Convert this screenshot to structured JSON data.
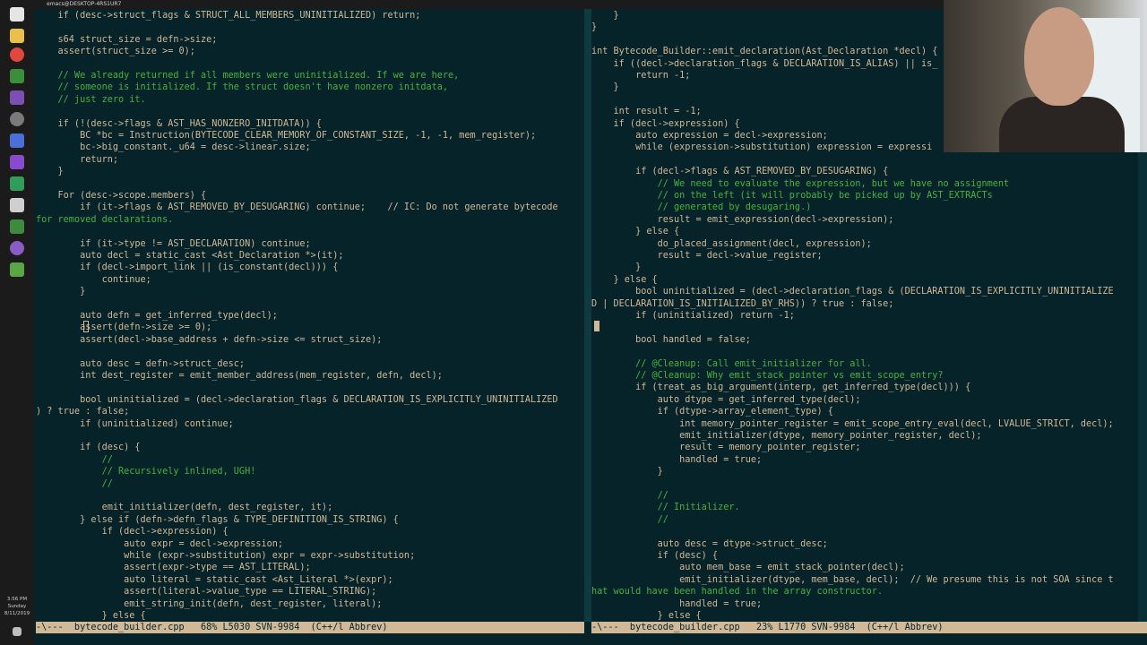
{
  "window_title": "emacs@DESKTOP-4RS1UR7",
  "taskbar": {
    "clock_time": "3:56 PM",
    "clock_day": "Sunday",
    "clock_date": "8/11/2019",
    "icons": [
      "windows-start-icon",
      "file-explorer-icon",
      "chrome-icon",
      "notepad-icon",
      "app-icon",
      "app-icon",
      "app-icon",
      "app-icon",
      "app-icon",
      "app-icon",
      "app-icon",
      "app-icon",
      "app-icon"
    ]
  },
  "colors": {
    "background": "#062329",
    "code": "#d1b897",
    "comment": "#44b340",
    "modeline_bg": "#d1b897"
  },
  "left_pane": {
    "lines": [
      {
        "t": "    if (desc->struct_flags & STRUCT_ALL_MEMBERS_UNINITIALIZED) return;",
        "c": false
      },
      {
        "t": "",
        "c": false
      },
      {
        "t": "    s64 struct_size = defn->size;",
        "c": false
      },
      {
        "t": "    assert(struct_size >= 0);",
        "c": false
      },
      {
        "t": "",
        "c": false
      },
      {
        "t": "    // We already returned if all members were uninitialized. If we are here,",
        "c": true
      },
      {
        "t": "    // someone is initialized. If the struct doesn't have nonzero initdata,",
        "c": true
      },
      {
        "t": "    // just zero it.",
        "c": true
      },
      {
        "t": "",
        "c": false
      },
      {
        "t": "    if (!(desc->flags & AST_HAS_NONZERO_INITDATA)) {",
        "c": false
      },
      {
        "t": "        BC *bc = Instruction(BYTECODE_CLEAR_MEMORY_OF_CONSTANT_SIZE, -1, -1, mem_register);",
        "c": false
      },
      {
        "t": "        bc->big_constant._u64 = desc->linear.size;",
        "c": false
      },
      {
        "t": "        return;",
        "c": false
      },
      {
        "t": "    }",
        "c": false
      },
      {
        "t": "",
        "c": false
      },
      {
        "t": "    For (desc->scope.members) {",
        "c": false
      },
      {
        "t": "        if (it->flags & AST_REMOVED_BY_DESUGARING) continue;    // IC: Do not generate bytecode",
        "c": false
      },
      {
        "t": "for removed declarations.",
        "c": true
      },
      {
        "t": "",
        "c": false
      },
      {
        "t": "        if (it->type != AST_DECLARATION) continue;",
        "c": false
      },
      {
        "t": "        auto decl = static_cast <Ast_Declaration *>(it);",
        "c": false
      },
      {
        "t": "        if (decl->import_link || (is_constant(decl))) {",
        "c": false
      },
      {
        "t": "            continue;",
        "c": false
      },
      {
        "t": "        }",
        "c": false
      },
      {
        "t": "",
        "c": false
      },
      {
        "t": "        auto defn = get_inferred_type(decl);",
        "c": false
      },
      {
        "t": "        assert(defn->size >= 0);",
        "c": false
      },
      {
        "t": "        assert(decl->base_address + defn->size <= struct_size);",
        "c": false
      },
      {
        "t": "",
        "c": false
      },
      {
        "t": "        auto desc = defn->struct_desc;",
        "c": false
      },
      {
        "t": "        int dest_register = emit_member_address(mem_register, defn, decl);",
        "c": false
      },
      {
        "t": "",
        "c": false
      },
      {
        "t": "        bool uninitialized = (decl->declaration_flags & DECLARATION_IS_EXPLICITLY_UNINITIALIZED",
        "c": false
      },
      {
        "t": ") ? true : false;",
        "c": false
      },
      {
        "t": "        if (uninitialized) continue;",
        "c": false
      },
      {
        "t": "",
        "c": false
      },
      {
        "t": "        if (desc) {",
        "c": false
      },
      {
        "t": "            //",
        "c": true
      },
      {
        "t": "            // Recursively inlined, UGH!",
        "c": true
      },
      {
        "t": "            //",
        "c": true
      },
      {
        "t": "",
        "c": false
      },
      {
        "t": "            emit_initializer(defn, dest_register, it);",
        "c": false
      },
      {
        "t": "        } else if (defn->defn_flags & TYPE_DEFINITION_IS_STRING) {",
        "c": false
      },
      {
        "t": "            if (decl->expression) {",
        "c": false
      },
      {
        "t": "                auto expr = decl->expression;",
        "c": false
      },
      {
        "t": "                while (expr->substitution) expr = expr->substitution;",
        "c": false
      },
      {
        "t": "                assert(expr->type == AST_LITERAL);",
        "c": false
      },
      {
        "t": "                auto literal = static_cast <Ast_Literal *>(expr);",
        "c": false
      },
      {
        "t": "                assert(literal->value_type == LITERAL_STRING);",
        "c": false
      },
      {
        "t": "                emit_string_init(defn, dest_register, literal);",
        "c": false
      },
      {
        "t": "            } else {",
        "c": false
      }
    ]
  },
  "right_pane": {
    "lines": [
      {
        "t": "    }",
        "c": false
      },
      {
        "t": "}",
        "c": false
      },
      {
        "t": "",
        "c": false
      },
      {
        "t": "int Bytecode_Builder::emit_declaration(Ast_Declaration *decl) {",
        "c": false
      },
      {
        "t": "    if ((decl->declaration_flags & DECLARATION_IS_ALIAS) || is_",
        "c": false
      },
      {
        "t": "        return -1;",
        "c": false
      },
      {
        "t": "    }",
        "c": false
      },
      {
        "t": "",
        "c": false
      },
      {
        "t": "    int result = -1;",
        "c": false
      },
      {
        "t": "    if (decl->expression) {",
        "c": false
      },
      {
        "t": "        auto expression = decl->expression;",
        "c": false
      },
      {
        "t": "        while (expression->substitution) expression = expressi",
        "c": false
      },
      {
        "t": "",
        "c": false
      },
      {
        "t": "        if (decl->flags & AST_REMOVED_BY_DESUGARING) {",
        "c": false
      },
      {
        "t": "            // We need to evaluate the expression, but we have no assignment",
        "c": true
      },
      {
        "t": "            // on the left (it will probably be picked up by AST_EXTRACTs",
        "c": true
      },
      {
        "t": "            // generated by desugaring.)",
        "c": true
      },
      {
        "t": "            result = emit_expression(decl->expression);",
        "c": false
      },
      {
        "t": "        } else {",
        "c": false
      },
      {
        "t": "            do_placed_assignment(decl, expression);",
        "c": false
      },
      {
        "t": "            result = decl->value_register;",
        "c": false
      },
      {
        "t": "        }",
        "c": false
      },
      {
        "t": "    } else {",
        "c": false
      },
      {
        "t": "        bool uninitialized = (decl->declaration_flags & (DECLARATION_IS_EXPLICITLY_UNINITIALIZE",
        "c": false
      },
      {
        "t": "D | DECLARATION_IS_INITIALIZED_BY_RHS)) ? true : false;",
        "c": false
      },
      {
        "t": "        if (uninitialized) return -1;",
        "c": false
      },
      {
        "t": "",
        "c": false
      },
      {
        "t": "        bool handled = false;",
        "c": false
      },
      {
        "t": "",
        "c": false
      },
      {
        "t": "        // @Cleanup: Call emit_initializer for all.",
        "c": true
      },
      {
        "t": "        // @Cleanup: Why emit_stack_pointer vs emit_scope_entry?",
        "c": true
      },
      {
        "t": "        if (treat_as_big_argument(interp, get_inferred_type(decl))) {",
        "c": false
      },
      {
        "t": "            auto dtype = get_inferred_type(decl);",
        "c": false
      },
      {
        "t": "            if (dtype->array_element_type) {",
        "c": false
      },
      {
        "t": "                int memory_pointer_register = emit_scope_entry_eval(decl, LVALUE_STRICT, decl);",
        "c": false
      },
      {
        "t": "                emit_initializer(dtype, memory_pointer_register, decl);",
        "c": false
      },
      {
        "t": "                result = memory_pointer_register;",
        "c": false
      },
      {
        "t": "                handled = true;",
        "c": false
      },
      {
        "t": "            }",
        "c": false
      },
      {
        "t": "",
        "c": false
      },
      {
        "t": "            //",
        "c": true
      },
      {
        "t": "            // Initializer.",
        "c": true
      },
      {
        "t": "            //",
        "c": true
      },
      {
        "t": "",
        "c": false
      },
      {
        "t": "            auto desc = dtype->struct_desc;",
        "c": false
      },
      {
        "t": "            if (desc) {",
        "c": false
      },
      {
        "t": "                auto mem_base = emit_stack_pointer(decl);",
        "c": false
      },
      {
        "t": "                emit_initializer(dtype, mem_base, decl);  // We presume this is not SOA since t",
        "c": false
      },
      {
        "t": "hat would have been handled in the array constructor.",
        "c": true
      },
      {
        "t": "                handled = true;",
        "c": false
      },
      {
        "t": "            } else {",
        "c": false
      }
    ]
  },
  "modeline_left": "-\\---  bytecode_builder.cpp   68% L5030 SVN-9984  (C++/l Abbrev)",
  "modeline_right": "-\\---  bytecode_builder.cpp   23% L1770 SVN-9984  (C++/l Abbrev)"
}
